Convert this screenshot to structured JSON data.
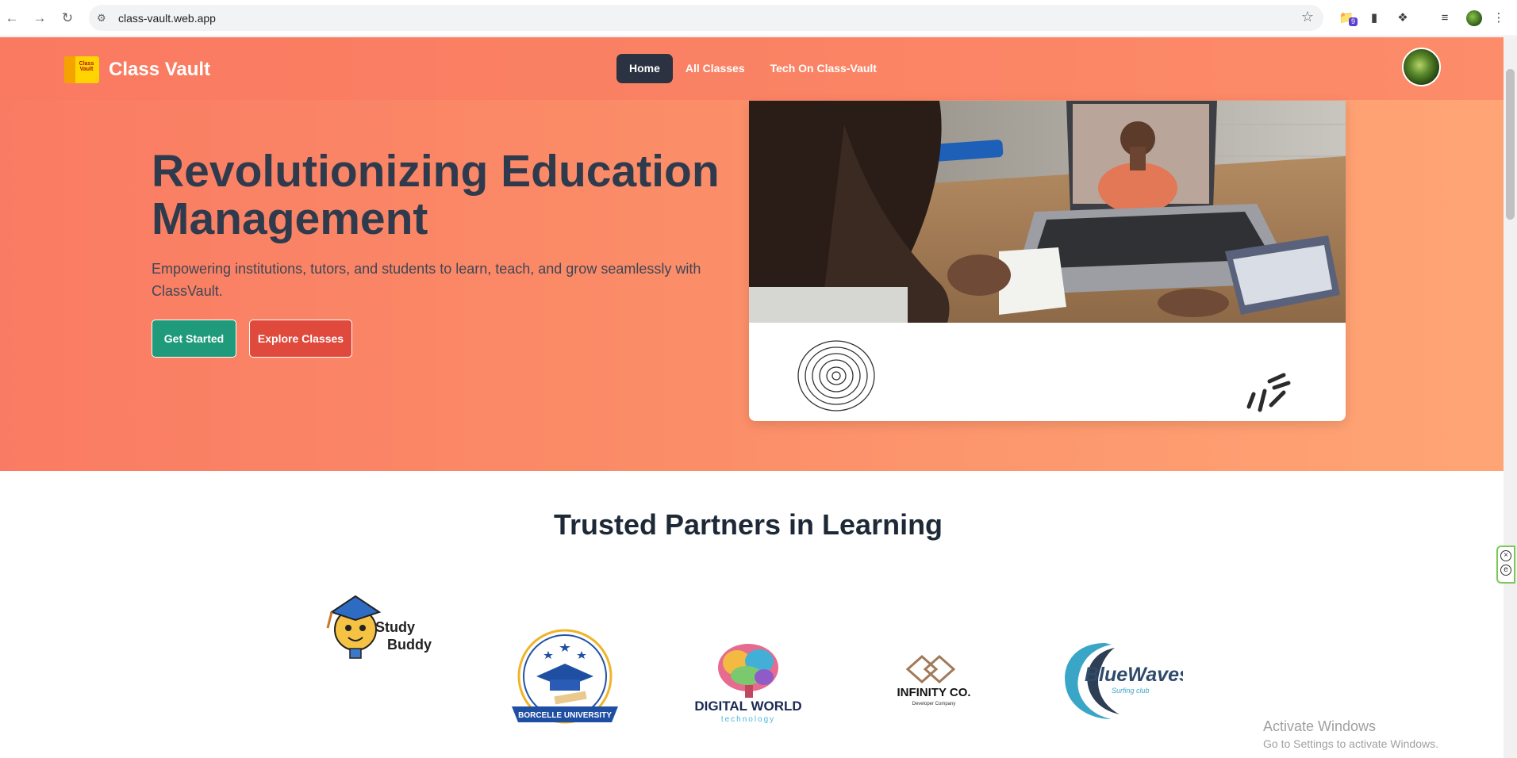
{
  "browser": {
    "url": "class-vault.web.app",
    "extension_badge": "9"
  },
  "nav": {
    "brand_name": "Class Vault",
    "brand_logo_text": "Class Vault",
    "items": [
      {
        "label": "Home",
        "active": true
      },
      {
        "label": "All Classes",
        "active": false
      },
      {
        "label": "Tech On Class-Vault",
        "active": false
      }
    ]
  },
  "hero": {
    "title": "Revolutionizing Education Management",
    "subtitle": "Empowering institutions, tutors, and students to learn, teach, and grow seamlessly with ClassVault.",
    "primary_button": "Get Started",
    "secondary_button": "Explore Classes"
  },
  "partners": {
    "title": "Trusted Partners in Learning",
    "logos": [
      {
        "name": "Study Buddy",
        "line1": "Study",
        "line2": "Buddy"
      },
      {
        "name": "Borcelle University",
        "text": "BORCELLE UNIVERSITY"
      },
      {
        "name": "Digital World",
        "text": "DIGITAL WORLD",
        "sub": "technology"
      },
      {
        "name": "Infinity Co.",
        "text": "INFINITY CO.",
        "sub": "Developer Company"
      },
      {
        "name": "BlueWaves",
        "text": "BlueWaves",
        "sub": "Surfing club"
      }
    ]
  },
  "watermark": {
    "line1": "Activate Windows",
    "line2": "Go to Settings to activate Windows."
  },
  "colors": {
    "hero_start": "#fa7b63",
    "hero_end": "#ffa575",
    "nav_active": "#2b3241",
    "get_started": "#1f9a7a",
    "explore": "#df4a3d",
    "title_text": "#2f3b4d"
  }
}
